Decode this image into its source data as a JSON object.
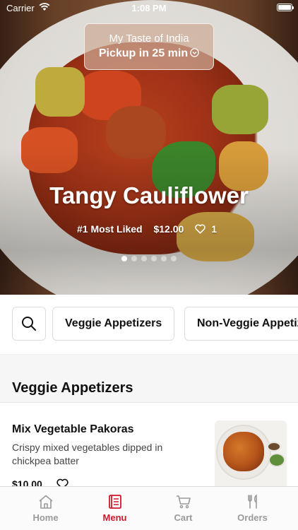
{
  "status_bar": {
    "carrier": "Carrier",
    "time": "1:08 PM"
  },
  "store": {
    "name": "My Taste of India",
    "pickup": "Pickup in 25 min"
  },
  "hero": {
    "title": "Tangy Cauliflower",
    "badge": "#1 Most Liked",
    "price": "$12.00",
    "likes": "1",
    "page_count": 6,
    "active_page": 1
  },
  "categories": {
    "items": [
      {
        "label": "Veggie Appetizers"
      },
      {
        "label": "Non-Veggie Appetizers"
      }
    ]
  },
  "section": {
    "title": "Veggie Appetizers"
  },
  "menu_items": [
    {
      "name": "Mix Vegetable Pakoras",
      "description": "Crispy mixed vegetables dipped in chickpea batter",
      "price": "$10.00"
    }
  ],
  "tabs": [
    {
      "label": "Home",
      "icon": "home-icon",
      "active": false
    },
    {
      "label": "Menu",
      "icon": "menu-book-icon",
      "active": true
    },
    {
      "label": "Cart",
      "icon": "cart-icon",
      "active": false
    },
    {
      "label": "Orders",
      "icon": "fork-knife-icon",
      "active": false
    }
  ],
  "colors": {
    "accent": "#d0162b",
    "inactive_tab": "#9a9a9a"
  }
}
